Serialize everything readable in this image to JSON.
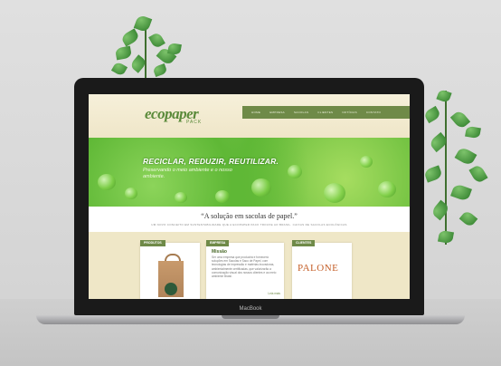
{
  "device": {
    "brand_label": "MacBook"
  },
  "site": {
    "logo": {
      "main": "ecopaper",
      "sub": "PACK"
    },
    "nav": [
      "HOME",
      "EMPRESA",
      "SACOLAS",
      "CLIENTES",
      "NOTÍCIAS",
      "CONTATO"
    ],
    "hero": {
      "title": "RECICLAR, REDUZIR, REUTILIZAR.",
      "subtitle": "Preservando o meio ambiente e o nosso ambiente."
    },
    "quote": {
      "title": "“A solução em sacolas de papel.”",
      "subtitle": "UM NOVO CONCEITO EM SUSTENTABILIDADE QUE A ECOPAPER PACK TROUXE AO BRASIL. CAIXAS DE SACOLAS ECOLÓGICAS"
    },
    "cards": {
      "produtos": {
        "tag": "PRODUTOS"
      },
      "empresa": {
        "tag": "EMPRESA",
        "title": "Missão",
        "text": "Ser uma empresa que produzirá e fornecerá soluções em Sacolas e Saco de Papel, com tecnologias de impressão e matérias inovadoras, ambientalmente certificadas, que valorizarão a comunicação visual dos nossos clientes e ao meio ambiente Brasil.",
        "link": "Leia mais"
      },
      "clientes": {
        "tag": "CLIENTES",
        "client_logo": "PALONE"
      }
    }
  },
  "colors": {
    "accent": "#6f8a48",
    "hero_green": "#5fb836",
    "cream": "#efe7c7"
  }
}
